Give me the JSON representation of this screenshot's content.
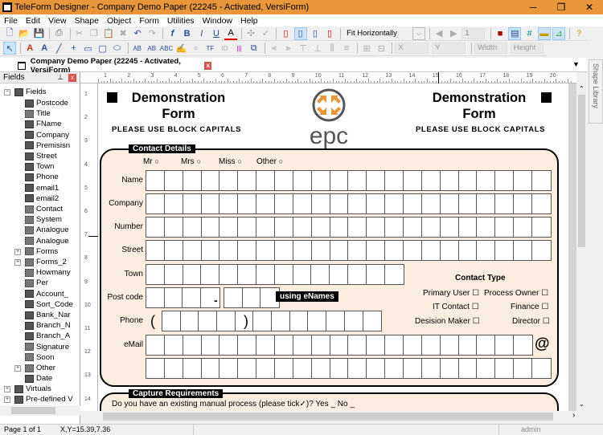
{
  "window": {
    "title": "TeleForm Designer - Company Demo Paper (22245 - Activated, VersiForm)",
    "minimize": "─",
    "maximize": "❐",
    "close": "✕"
  },
  "menu": [
    "File",
    "Edit",
    "View",
    "Shape",
    "Object",
    "Form",
    "Utilities",
    "Window",
    "Help"
  ],
  "toolbar1": {
    "zoom_select": "Fit Horizontally",
    "page_field": "1"
  },
  "toolbar2": {
    "x_placeholder": "X",
    "y_placeholder": "Y",
    "width_placeholder": "Width",
    "height_placeholder": "Height"
  },
  "doc_tab": {
    "label": "Company Demo Paper (22245 - Activated, VersiForm)",
    "close": "x"
  },
  "fields_panel": {
    "title": "Fields",
    "pin": "⊥",
    "close": "x",
    "root": "Fields",
    "items": [
      {
        "name": "Postcode",
        "type": "text"
      },
      {
        "name": "Title",
        "type": "choice"
      },
      {
        "name": "FName",
        "type": "text"
      },
      {
        "name": "Company",
        "type": "text"
      },
      {
        "name": "Premisisn",
        "type": "text"
      },
      {
        "name": "Street",
        "type": "text"
      },
      {
        "name": "Town",
        "type": "text"
      },
      {
        "name": "Phone",
        "type": "text"
      },
      {
        "name": "email1",
        "type": "text"
      },
      {
        "name": "email2",
        "type": "text"
      },
      {
        "name": "Contact",
        "type": "choice"
      },
      {
        "name": "System",
        "type": "choice"
      },
      {
        "name": "Analogue",
        "type": "choice"
      },
      {
        "name": "Analogue",
        "type": "choice"
      },
      {
        "name": "Forms",
        "type": "choice",
        "expandable": true
      },
      {
        "name": "Forms_2",
        "type": "choice",
        "expandable": true
      },
      {
        "name": "Howmany",
        "type": "choice"
      },
      {
        "name": "Per",
        "type": "choice"
      },
      {
        "name": "Account_",
        "type": "text"
      },
      {
        "name": "Sort_Code",
        "type": "text"
      },
      {
        "name": "Bank_Nar",
        "type": "text"
      },
      {
        "name": "Branch_N",
        "type": "text"
      },
      {
        "name": "Branch_A",
        "type": "text"
      },
      {
        "name": "Signature",
        "type": "signature"
      },
      {
        "name": "Soon",
        "type": "choice"
      },
      {
        "name": "Other",
        "type": "group",
        "expandable": true
      },
      {
        "name": "Date",
        "type": "text"
      }
    ],
    "others": [
      "Virtuals",
      "Pre-defined V"
    ]
  },
  "ruler_h": [
    "1",
    "2",
    "3",
    "4",
    "5",
    "6",
    "7",
    "8",
    "9",
    "10",
    "11",
    "12",
    "13",
    "14",
    "15",
    "16",
    "17",
    "18",
    "19",
    "20"
  ],
  "ruler_v": [
    "1",
    "2",
    "3",
    "4",
    "5",
    "6",
    "7",
    "8",
    "9",
    "10",
    "11",
    "12",
    "13",
    "14"
  ],
  "form": {
    "title_left": "Demonstration Form",
    "title_right": "Demonstration Form",
    "subtitle": "PLEASE USE BLOCK CAPITALS",
    "logo_text": "epc",
    "brand_color": "#e8963a",
    "panel_fill": "#fbeee0",
    "contact_details": "Contact Details",
    "titles": [
      "Mr",
      "Mrs",
      "Miss",
      "Other"
    ],
    "rows": [
      "Name",
      "Company",
      "Number",
      "Street",
      "Town",
      "Post code",
      "Phone",
      "eMail"
    ],
    "dash": "-",
    "paren_open": "(",
    "paren_close": ")",
    "at": "@",
    "using_enames": "using eNames",
    "contact_type": {
      "heading": "Contact Type",
      "options": [
        "Primary User",
        "Process Owner",
        "IT Contact",
        "Finance",
        "Desision Maker",
        "Director"
      ]
    },
    "capture_requirements": "Capture Requirements",
    "question": "Do you have an existing manual process (please tick",
    "question_end": ")?  Yes _     No  _"
  },
  "shape_library": "Shape Library",
  "status": {
    "page": "Page 1 of 1",
    "coords": "X,Y=15.39,7.36",
    "user": "admin"
  }
}
